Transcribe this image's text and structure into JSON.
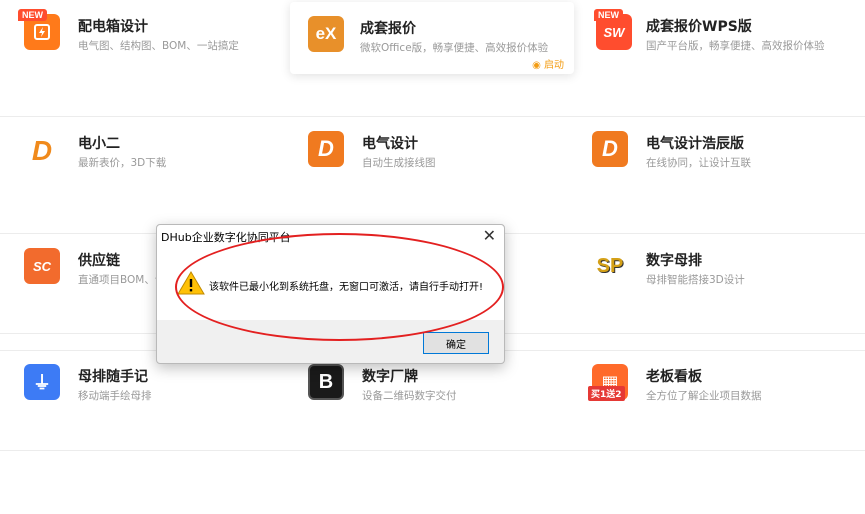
{
  "apps": [
    {
      "title": "配电箱设计",
      "desc": "电气图、结构图、BOM、一站搞定",
      "icon": "power-box-icon",
      "color": "#ff7a1a",
      "glyph": "⚡",
      "badge": "NEW"
    },
    {
      "title": "成套报价",
      "desc": "微软Office版，畅享便捷、高效报价体验",
      "icon": "ex-logo-icon",
      "color": "#f08a1c",
      "glyph": "eX",
      "launch": "启动"
    },
    {
      "title": "成套报价WPS版",
      "desc": "国产平台版，畅享便捷、高效报价体验",
      "icon": "sw-logo-icon",
      "color": "#ff4d2e",
      "glyph": "SW",
      "badge": "NEW"
    },
    {
      "title": "电小二",
      "desc": "最新表价，3D下载",
      "icon": "d-logo-icon",
      "color": "#ffffff",
      "glyph": "D"
    },
    {
      "title": "电气设计",
      "desc": "自动生成接线图",
      "icon": "d-logo-icon",
      "color": "#f07a20",
      "glyph": "D"
    },
    {
      "title": "电气设计浩辰版",
      "desc": "在线协同，让设计互联",
      "icon": "d-logo-icon",
      "color": "#f07a20",
      "glyph": "D"
    },
    {
      "title": "供应链",
      "desc": "直通项目BOM、讲",
      "icon": "sc-logo-icon",
      "color": "#f26b2d",
      "glyph": "SC"
    },
    {
      "title": "",
      "desc": "",
      "icon": "",
      "color": "",
      "glyph": ""
    },
    {
      "title": "数字母排",
      "desc": "母排智能搭接3D设计",
      "icon": "sp-logo-icon",
      "color": "#ffffff",
      "glyph": "SP"
    },
    {
      "title": "母排随手记",
      "desc": "移动端手绘母排",
      "icon": "busbar-note-icon",
      "color": "#3d7bf5",
      "glyph": "⏚"
    },
    {
      "title": "数字厂牌",
      "desc": "设备二维码数字交付",
      "icon": "b-logo-icon",
      "color": "#1a1a1a",
      "glyph": "B"
    },
    {
      "title": "老板看板",
      "desc": "全方位了解企业项目数据",
      "icon": "dashboard-icon",
      "color": "#ff6a2a",
      "glyph": "▦",
      "promo": "买1送2"
    }
  ],
  "dialog": {
    "title": "DHub企业数字化协同平台",
    "message": "该软件已最小化到系统托盘，无窗口可激活，请自行手动打开!",
    "ok": "确定",
    "close": "✕"
  }
}
